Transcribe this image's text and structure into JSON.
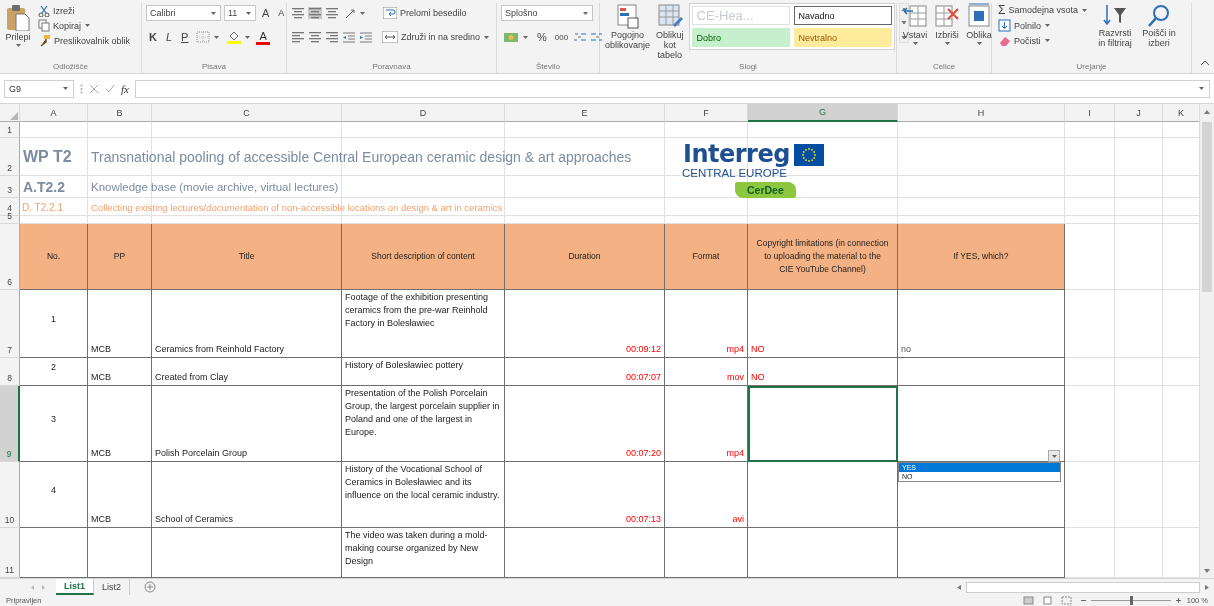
{
  "ribbon": {
    "groups": [
      {
        "kind": "clipboard",
        "label": "Odložišče",
        "paste": "Prilepi",
        "cut": "Izreži",
        "copy": "Kopiraj",
        "painter": "Preslikovalnik oblik"
      },
      {
        "kind": "font",
        "label": "Pisava",
        "font_name": "Calibri",
        "font_size": "11",
        "grow": "A",
        "shrink": "A",
        "bold": "K",
        "italic": "L",
        "underline": "P",
        "font_color": "A"
      },
      {
        "kind": "alignment",
        "label": "Poravnava",
        "wrap": "Prelomi besedilo",
        "merge": "Združi in na sredino"
      },
      {
        "kind": "number",
        "label": "Število",
        "format": "Splošno",
        "percent": "%",
        "thousands": "000"
      },
      {
        "kind": "styles",
        "label": "Slogi",
        "conditional": "Pogojno oblikovanje",
        "as_table": "Oblikuj kot tabelo",
        "cell_styles": [
          {
            "label": "CE-Hea...",
            "kind": "heading"
          },
          {
            "label": "Navadno",
            "kind": "normal"
          },
          {
            "label": "Dobro",
            "kind": "good"
          },
          {
            "label": "Nevtralno",
            "kind": "neutral"
          }
        ]
      },
      {
        "kind": "cells",
        "label": "Celice",
        "buttons": [
          "Vstavi",
          "Izbriši",
          "Oblika"
        ]
      },
      {
        "kind": "editing",
        "label": "Urejanje",
        "sigma": "Σ",
        "autosum": "Samodejna vsota",
        "fill": "Polnilo",
        "clear": "Počisti",
        "sort": "Razvrsti in filtriraj",
        "find": "Poišči in izberi"
      }
    ]
  },
  "formula_bar": {
    "name_box": "G9",
    "function_label": "fx"
  },
  "sheet": {
    "columns": [
      {
        "label": "A",
        "selected": false
      },
      {
        "label": "B",
        "selected": false
      },
      {
        "label": "C",
        "selected": false
      },
      {
        "label": "D",
        "selected": false
      },
      {
        "label": "E",
        "selected": false
      },
      {
        "label": "F",
        "selected": false
      },
      {
        "label": "G",
        "selected": true
      },
      {
        "label": "H",
        "selected": false
      },
      {
        "label": "I",
        "selected": false
      },
      {
        "label": "J",
        "selected": false
      },
      {
        "label": "K",
        "selected": false
      }
    ],
    "rows": [
      {
        "label": "1",
        "selected": false
      },
      {
        "label": "2",
        "selected": false
      },
      {
        "label": "3",
        "selected": false
      },
      {
        "label": "4",
        "selected": false
      },
      {
        "label": "5",
        "selected": false
      },
      {
        "label": "6",
        "selected": false
      },
      {
        "label": "7",
        "selected": false
      },
      {
        "label": "8",
        "selected": false
      },
      {
        "label": "9",
        "selected": true
      },
      {
        "label": "10",
        "selected": false
      },
      {
        "label": "11",
        "selected": false
      }
    ],
    "heading": {
      "code": "WP T2",
      "title": "Transnational pooling of accessible Central European ceramic design & art approaches"
    },
    "activity": {
      "code": "A.T2.2",
      "title": "Knowledge base (movie archive, virtual lectures)"
    },
    "deliverable": {
      "code": "D. T2.2.1",
      "title": "Collecting existing lectures/documentation of non-accessible locations on design & art in ceramics"
    },
    "logo": {
      "name": "Interreg",
      "region": "CENTRAL EUROPE",
      "project": "CerDee"
    },
    "table": {
      "headers": [
        "No.",
        "PP",
        "Title",
        "Short description of content",
        "Duration",
        "Format",
        "Copyright limitations (in connection to uploading the material to the CIE YouTube Channel)",
        "If YES, which?"
      ],
      "rows": [
        {
          "no": "1",
          "pp": "MCB",
          "title": "Ceramics from Reinhold Factory",
          "description": "Footage of the exhibition presenting ceramics from the pre-war Reinhold Factory in Bolesławiec",
          "duration": "00:09:12",
          "format": "mp4",
          "copyright": "NO",
          "which": "no"
        },
        {
          "no": "2",
          "pp": "MCB",
          "title": "Created from Clay",
          "description": "History of Bolesławiec pottery",
          "duration": "00:07:07",
          "format": "mov",
          "copyright": "NO"
        },
        {
          "no": "3",
          "pp": "MCB",
          "title": "Polish Porcelain Group",
          "description": "Presentation of the Polish Porcelain Group, the largest porcelain supplier in Poland and one of the largest in Europe.",
          "duration": "00:07:20",
          "format": "mp4"
        },
        {
          "no": "4",
          "pp": "MCB",
          "title": "School of Ceramics",
          "description": "History of the Vocational School of Ceramics in Bolesławiec and its influence on the local ceramic industry.",
          "duration": "00:07:13",
          "format": "avi"
        },
        {
          "description": "The video was taken during a mold-making course organized by New Design"
        }
      ]
    },
    "dropdown": {
      "options": [
        {
          "label": "YES",
          "selected": true
        },
        {
          "label": "NO",
          "selected": false
        }
      ]
    }
  },
  "sheet_tabs": [
    {
      "label": "List1",
      "selected": true
    },
    {
      "label": "List2",
      "selected": false
    }
  ],
  "status_bar": {
    "text": "Pripravljen",
    "zoom": {
      "level": 0.5,
      "reading": "100 %"
    }
  }
}
